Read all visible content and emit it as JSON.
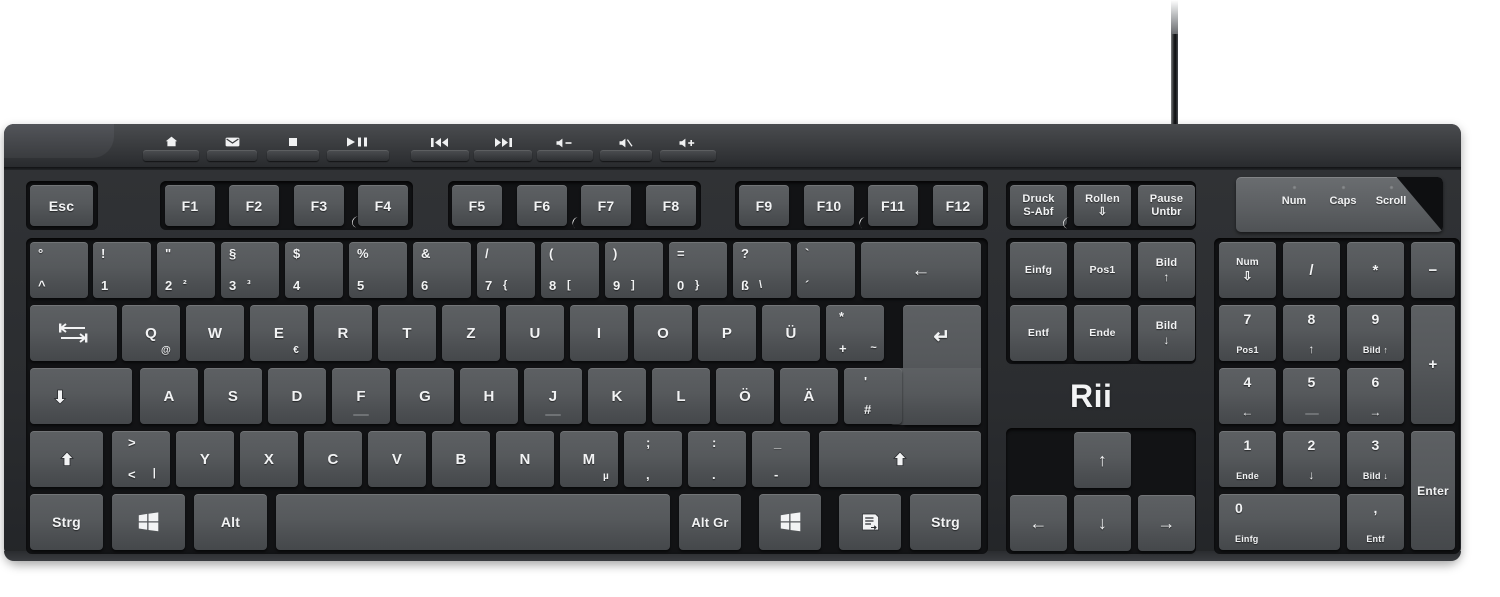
{
  "product": {
    "brand": "Rii",
    "layout": "German QWERTZ",
    "body_color": "#2c2e31",
    "key_color": "#56595c",
    "legend_color": "#f2f3f4"
  },
  "media_keys": [
    {
      "name": "home",
      "glyph": "⌂"
    },
    {
      "name": "mail",
      "glyph": "✉"
    },
    {
      "name": "stop",
      "glyph": "■"
    },
    {
      "name": "play-pause",
      "glyph": "▶❙❙"
    },
    {
      "name": "previous-track",
      "glyph": "⏮"
    },
    {
      "name": "next-track",
      "glyph": "⏭"
    },
    {
      "name": "volume-down",
      "glyph": "◂-"
    },
    {
      "name": "mute",
      "glyph": "◂"
    },
    {
      "name": "volume-up",
      "glyph": "◂+"
    }
  ],
  "leds": [
    {
      "label": "Num"
    },
    {
      "label": "Caps"
    },
    {
      "label": "Scroll"
    }
  ],
  "function_row": {
    "esc": "Esc",
    "group1": [
      "F1",
      "F2",
      "F3",
      "F4"
    ],
    "group2": [
      "F5",
      "F6",
      "F7",
      "F8"
    ],
    "group3": [
      "F9",
      "F10",
      "F11",
      "F12"
    ],
    "system": [
      {
        "top": "Druck",
        "bottom": "S-Abf"
      },
      {
        "top": "Rollen",
        "bottom": "⇩"
      },
      {
        "top": "Pause",
        "bottom": "Untbr"
      }
    ]
  },
  "number_row": [
    {
      "top": "°",
      "bottom": "^"
    },
    {
      "top": "!",
      "bottom": "1"
    },
    {
      "top": "\"",
      "bottom": "2",
      "alt": "²"
    },
    {
      "top": "§",
      "bottom": "3",
      "alt": "³"
    },
    {
      "top": "$",
      "bottom": "4"
    },
    {
      "top": "%",
      "bottom": "5"
    },
    {
      "top": "&",
      "bottom": "6"
    },
    {
      "top": "/",
      "bottom": "7",
      "altgr": "{"
    },
    {
      "top": "(",
      "bottom": "8",
      "altgr": "["
    },
    {
      "top": ")",
      "bottom": "9",
      "altgr": "]"
    },
    {
      "top": "=",
      "bottom": "0",
      "altgr": "}"
    },
    {
      "top": "?",
      "bottom": "ß",
      "altgr": "\\"
    },
    {
      "top": "`",
      "bottom": "´"
    }
  ],
  "backspace_label": "←",
  "tab_label": "tab",
  "qwertz_row": [
    {
      "main": "Q",
      "sub": "@"
    },
    {
      "main": "W"
    },
    {
      "main": "E",
      "sub": "€"
    },
    {
      "main": "R"
    },
    {
      "main": "T"
    },
    {
      "main": "Z"
    },
    {
      "main": "U"
    },
    {
      "main": "I"
    },
    {
      "main": "O"
    },
    {
      "main": "P"
    },
    {
      "main": "Ü"
    },
    {
      "top": "*",
      "bottom": "+",
      "altgr": "~"
    }
  ],
  "enter_label": "↵",
  "capslock_label": "caps-lock",
  "home_row": [
    {
      "main": "A"
    },
    {
      "main": "S"
    },
    {
      "main": "D"
    },
    {
      "main": "F"
    },
    {
      "main": "G"
    },
    {
      "main": "H"
    },
    {
      "main": "J"
    },
    {
      "main": "K"
    },
    {
      "main": "L"
    },
    {
      "main": "Ö"
    },
    {
      "main": "Ä"
    },
    {
      "top": "'",
      "bottom": "#"
    }
  ],
  "shift_left_label": "⇧",
  "shift_right_label": "⇧",
  "bottom_row_alpha": [
    {
      "top": ">",
      "bottom": "<",
      "altgr": "|"
    },
    {
      "main": "Y"
    },
    {
      "main": "X"
    },
    {
      "main": "C"
    },
    {
      "main": "V"
    },
    {
      "main": "B"
    },
    {
      "main": "N"
    },
    {
      "main": "M",
      "sub": "µ"
    },
    {
      "top": ";",
      "bottom": ","
    },
    {
      "top": ":",
      "bottom": "."
    },
    {
      "top": "_",
      "bottom": "-"
    }
  ],
  "modifier_row": {
    "ctrl_left": "Strg",
    "win_left": "windows-logo",
    "alt_left": "Alt",
    "space": "",
    "alt_gr": "Alt Gr",
    "win_right": "windows-logo",
    "menu": "context-menu",
    "ctrl_right": "Strg"
  },
  "nav_cluster": [
    {
      "top": "Einfg"
    },
    {
      "top": "Pos1"
    },
    {
      "top": "Bild",
      "bottom": "↑"
    },
    {
      "top": "Entf"
    },
    {
      "top": "Ende"
    },
    {
      "top": "Bild",
      "bottom": "↓"
    }
  ],
  "arrows": {
    "up": "↑",
    "left": "←",
    "down": "↓",
    "right": "→"
  },
  "numpad": {
    "row1": [
      {
        "top": "Num",
        "bottom": "⇩"
      },
      {
        "main": "/"
      },
      {
        "main": "*"
      },
      {
        "main": "−"
      }
    ],
    "row2": [
      {
        "num": "7",
        "sub": "Pos1"
      },
      {
        "num": "8",
        "sub": "↑"
      },
      {
        "num": "9",
        "sub": "Bild ↑"
      }
    ],
    "plus": "+",
    "row3": [
      {
        "num": "4",
        "sub": "←"
      },
      {
        "num": "5",
        "sub": ""
      },
      {
        "num": "6",
        "sub": "→"
      }
    ],
    "row4": [
      {
        "num": "1",
        "sub": "Ende"
      },
      {
        "num": "2",
        "sub": "↓"
      },
      {
        "num": "3",
        "sub": "Bild ↓"
      }
    ],
    "enter": "Enter",
    "row5": [
      {
        "num": "0",
        "sub": "Einfg"
      },
      {
        "num": ",",
        "sub": "Entf"
      }
    ]
  }
}
